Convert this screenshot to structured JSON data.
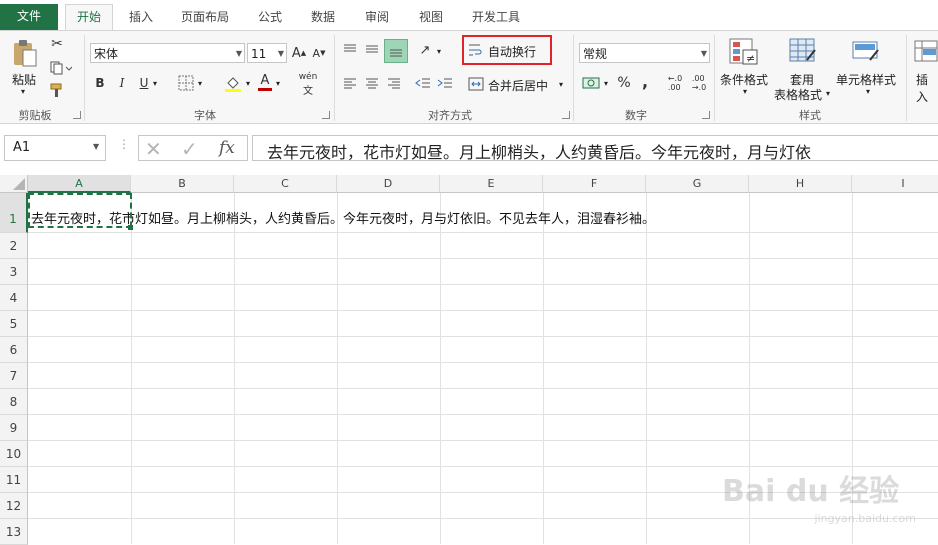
{
  "tabs": [
    "文件",
    "开始",
    "插入",
    "页面布局",
    "公式",
    "数据",
    "审阅",
    "视图",
    "开发工具"
  ],
  "clipboard": {
    "paste_label": "粘贴",
    "group_label": "剪贴板"
  },
  "font": {
    "font_name": "宋体",
    "font_size": "11",
    "group_label": "字体",
    "bold": "B",
    "italic": "I",
    "underline": "U",
    "grow": "A",
    "shrink": "A",
    "font_color_letter": "A",
    "phonetic": "wén"
  },
  "alignment": {
    "wrap_text_label": "自动换行",
    "merge_label": "合并后居中",
    "group_label": "对齐方式"
  },
  "number": {
    "format": "常规",
    "group_label": "数字",
    "percent": "%",
    "comma": ","
  },
  "styles": {
    "conditional_label": "条件格式",
    "table_format_line1": "套用",
    "table_format_line2": "表格格式",
    "cell_styles_label": "单元格样式",
    "group_label": "样式"
  },
  "cells_group": {
    "insert_label": "插入"
  },
  "formula_bar": {
    "name_box": "A1",
    "fx": "fx",
    "content": "去年元夜时，花市灯如昼。月上柳梢头，人约黄昏后。今年元夜时，月与灯依"
  },
  "sheet": {
    "columns": [
      "A",
      "B",
      "C",
      "D",
      "E",
      "F",
      "G",
      "H",
      "I"
    ],
    "rows": [
      "1",
      "2",
      "3",
      "4",
      "5",
      "6",
      "7",
      "8",
      "9",
      "10",
      "11",
      "12",
      "13"
    ],
    "a1_text": "去年元夜时，花市灯如昼。月上柳梢头，人约黄昏后。今年元夜时，月与灯依旧。不见去年人，泪湿春衫袖。"
  },
  "watermark": {
    "text": "Bai du 经验",
    "url": "jingyan.baidu.com"
  },
  "colors": {
    "excel_green": "#217346",
    "highlight_red": "#e0242b"
  }
}
